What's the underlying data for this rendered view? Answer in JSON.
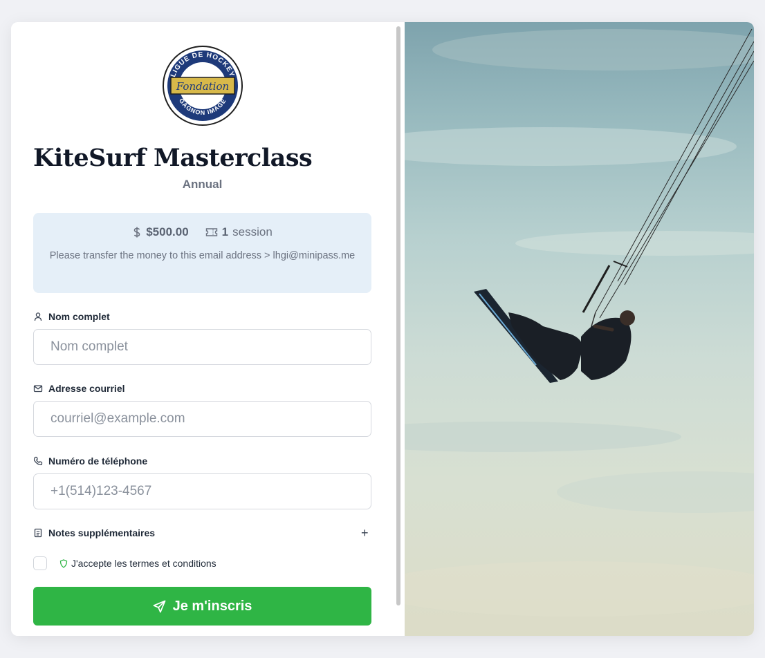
{
  "event": {
    "title": "KiteSurf Masterclass",
    "subtitle": "Annual"
  },
  "logo": {
    "top_text": "LIGUE DE HOCKEY",
    "center_text": "Fondation",
    "bottom_text": "GAGNON IMAGE"
  },
  "pricing": {
    "price": "$500.00",
    "sessions_count": "1",
    "sessions_label": "session",
    "note": "Please transfer the money to this email address > lhgi@minipass.me"
  },
  "form": {
    "name": {
      "label": "Nom complet",
      "placeholder": "Nom complet",
      "value": ""
    },
    "email": {
      "label": "Adresse courriel",
      "placeholder": "courriel@example.com",
      "value": ""
    },
    "phone": {
      "label": "Numéro de téléphone",
      "placeholder": "+1(514)123-4567",
      "value": ""
    },
    "notes": {
      "label": "Notes supplémentaires",
      "toggle": "+"
    },
    "terms": {
      "label": "J'accepte les termes et conditions",
      "checked": false
    },
    "submit_label": "Je m'inscris"
  },
  "colors": {
    "accent": "#2fb545",
    "price_box": "#e5eff8",
    "terms_icon": "#2fb545"
  },
  "icons": [
    "dollar-icon",
    "ticket-icon",
    "user-icon",
    "mail-icon",
    "phone-icon",
    "notes-icon",
    "shield-icon",
    "send-icon"
  ]
}
